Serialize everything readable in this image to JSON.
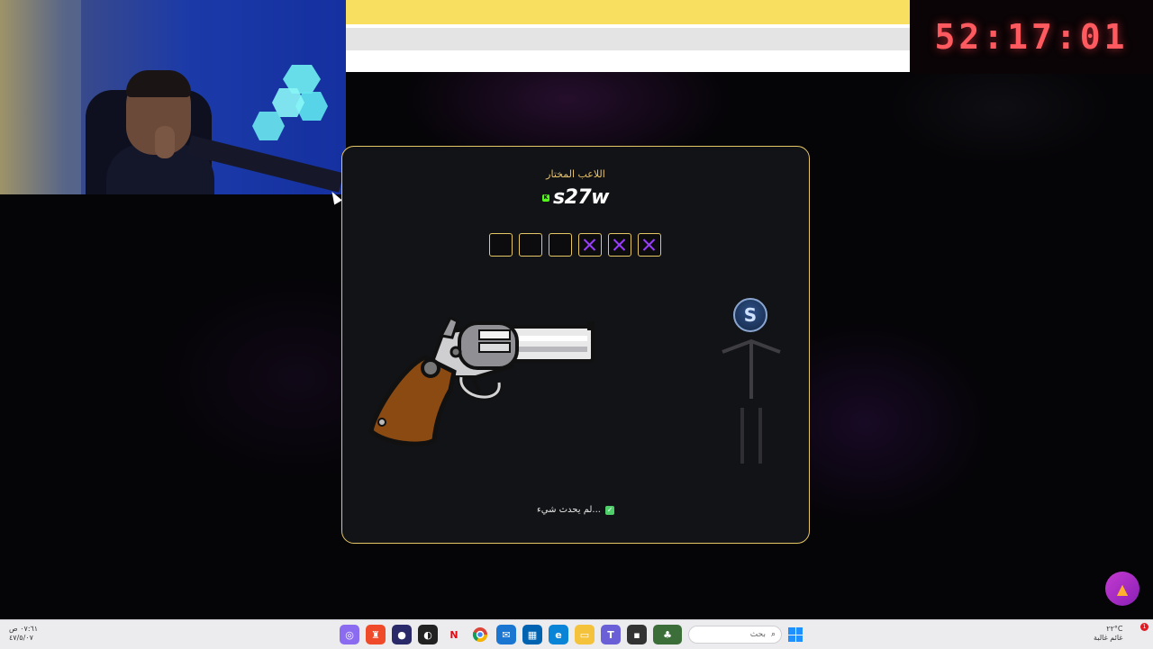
{
  "timer": {
    "value": "52:17:01"
  },
  "game": {
    "chosen_player_label": "اللاعب المختار",
    "player_name": "s27w",
    "slots": [
      {
        "state": "empty"
      },
      {
        "state": "empty"
      },
      {
        "state": "empty"
      },
      {
        "state": "used"
      },
      {
        "state": "used"
      },
      {
        "state": "used"
      }
    ],
    "avatar_letter": "S",
    "status_text": "لم يحدث شيء..."
  },
  "taskbar": {
    "time": "٠٧:٦١ ص",
    "date": "٤٧/٥/٠٧",
    "search_placeholder": "بحث",
    "weather_temp": "٢٢°C",
    "weather_desc": "غائم غالبة",
    "notification_count": "1"
  },
  "colors": {
    "accent_gold": "#e6c766",
    "timer_red": "#ff5a5f",
    "slot_used_purple": "#9b3dff",
    "fab_purple": "#c43bd0"
  }
}
